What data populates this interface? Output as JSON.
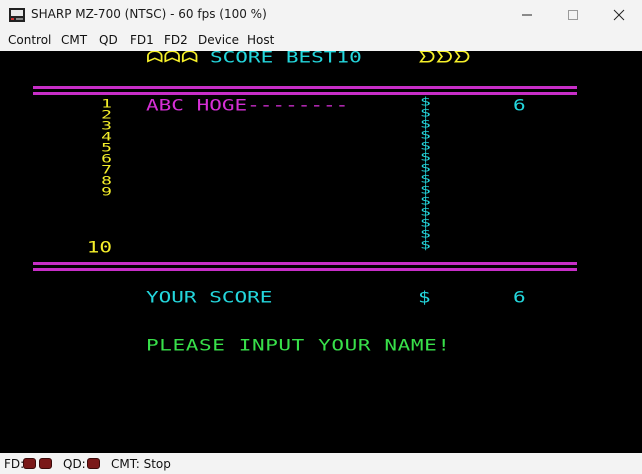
{
  "window": {
    "title": "SHARP MZ-700 (NTSC) - 60 fps (100 %)"
  },
  "menu": [
    "Control",
    "CMT",
    "QD",
    "FD1",
    "FD2",
    "Device",
    "Host"
  ],
  "game": {
    "header_left_deco": "ᗣᗣᗣ",
    "header_title": "SCORE BEST10",
    "header_right_deco": "ᗤᗤᗤ",
    "ranks": [
      "1",
      "2",
      "3",
      "4",
      "5",
      "6",
      "7",
      "8",
      "9",
      "10"
    ],
    "entries": [
      {
        "name": "ABC HOGE--------",
        "currency": "$",
        "score": "6"
      }
    ],
    "currency_symbol": "$",
    "your_score_label": "YOUR SCORE",
    "your_score_currency": "$",
    "your_score_value": "6",
    "prompt": "PLEASE INPUT YOUR NAME!",
    "colors": {
      "background": "#000000",
      "cyan": "#24d6dc",
      "magenta": "#d62fd6",
      "yellow": "#f5ef2a",
      "green": "#38e04a"
    }
  },
  "status": {
    "fd_label": "FD:",
    "qd_label": "QD:",
    "cmt_label": "CMT: Stop"
  }
}
